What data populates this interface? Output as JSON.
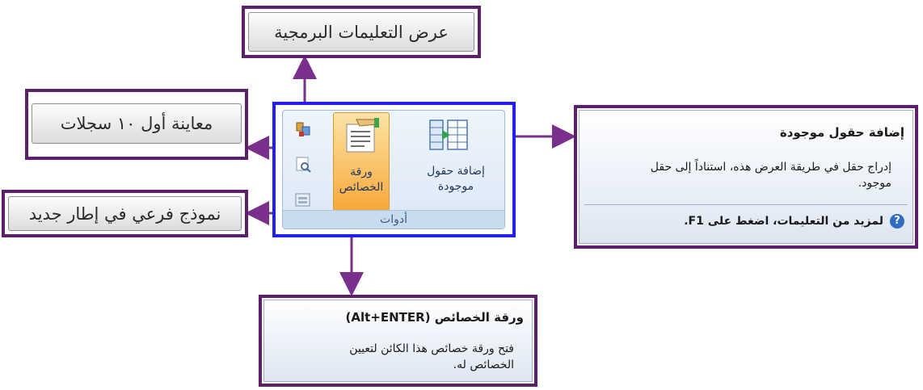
{
  "callouts": {
    "script_view": "عرض التعليمات البرمجية",
    "preview_records": "معاينة أول ١٠ سجلات",
    "subform_new_window": "نموذج فرعي في إطار جديد"
  },
  "ribbon": {
    "add_fields_label": "إضافة حقول\nموجودة",
    "property_sheet_label": "ورقة\nالخصائص",
    "group_label": "أدوات"
  },
  "tooltip_add_fields": {
    "title": "إضافة حقول موجودة",
    "body": "إدراج حقل في طريقة العرض هذه، استناداً إلى حقل موجود.",
    "help": "لمزيد من التعليمات، اضغط على F1."
  },
  "tooltip_property_sheet": {
    "title": "ورقة الخصائص (Alt+ENTER)",
    "body": "فتح ورقة خصائص هذا الكائن لتعيين الخصائص له."
  },
  "colors": {
    "callout_border": "#5b1f6b",
    "arrow": "#7a2e8e",
    "ribbon_frame": "#1f1ff0",
    "selected_button": "#f9b14a"
  },
  "icons": [
    "view-code-icon",
    "preview-icon",
    "subform-icon",
    "property-sheet-icon",
    "add-fields-icon",
    "help-icon"
  ]
}
